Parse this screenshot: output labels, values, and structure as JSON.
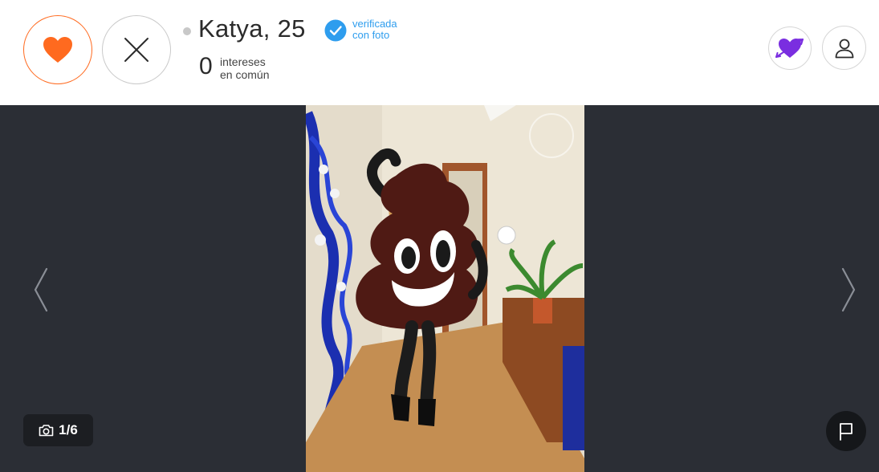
{
  "profile": {
    "name_age": "Katya, 25",
    "verified_line1": "verificada",
    "verified_line2": "con foto",
    "interests_count": "0",
    "interests_line1": "intereses",
    "interests_line2": "en común",
    "online_status_color": "#c8c8c8"
  },
  "actions": {
    "like_icon": "heart-icon",
    "dislike_icon": "close-icon",
    "cupid_icon": "heart-arrow-icon",
    "profile_icon": "user-icon",
    "report_icon": "flag-icon"
  },
  "gallery": {
    "counter": "1/6",
    "counter_icon": "camera-icon",
    "prev_icon": "chevron-left-icon",
    "next_icon": "chevron-right-icon"
  },
  "colors": {
    "like": "#ff6a1f",
    "verified": "#2e9dee",
    "cupid": "#7a2ee0",
    "stage_bg": "#2b2e35"
  }
}
